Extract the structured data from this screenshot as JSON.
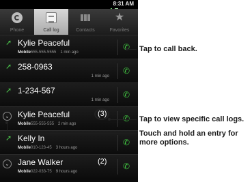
{
  "status_bar": {
    "time": "8:31 AM"
  },
  "tabs": [
    {
      "label": "Phone",
      "icon": "phone-icon",
      "active": false
    },
    {
      "label": "Call log",
      "icon": "call-log-icon",
      "active": true
    },
    {
      "label": "Contacts",
      "icon": "contacts-icon",
      "active": false
    },
    {
      "label": "Favorites",
      "icon": "favorites-icon",
      "active": false
    }
  ],
  "call_log": [
    {
      "name": "Kylie Peaceful",
      "type": "Mobile",
      "number": "555-555-5555",
      "time": "1 min ago"
    },
    {
      "name": "258-0963",
      "time": "1 min ago"
    },
    {
      "name": "1-234-567",
      "time": "1 min ago"
    },
    {
      "name": "Kylie Peaceful",
      "count": "(3)",
      "type": "Mobile",
      "number": "555-555-555",
      "time": "2 min ago"
    },
    {
      "name": "Kelly In",
      "type": "Mobile",
      "number": "010-123-45",
      "time": "3 hours ago"
    },
    {
      "name": "Jane Walker",
      "count": "(2)",
      "type": "Mobile",
      "number": "022-033-75",
      "time": "9 hours ago"
    }
  ],
  "annotations": {
    "call_back": "Tap to call back.",
    "view_logs": "Tap to view specific call logs.",
    "hold_entry_line1": "Touch and hold an entry for",
    "hold_entry_line2": "more options."
  },
  "colors": {
    "call_green": "#42c742",
    "background": "#0b0b0b"
  }
}
